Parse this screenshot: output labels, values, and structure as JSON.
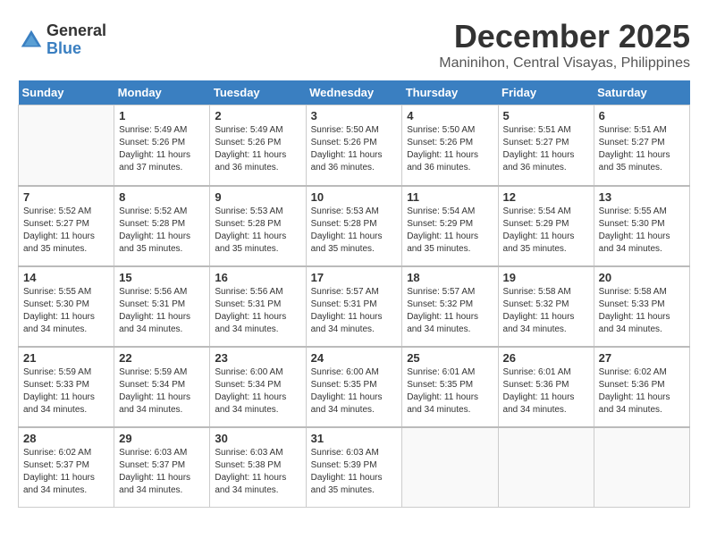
{
  "header": {
    "logo_general": "General",
    "logo_blue": "Blue",
    "month_year": "December 2025",
    "location": "Maninihon, Central Visayas, Philippines"
  },
  "calendar": {
    "days_of_week": [
      "Sunday",
      "Monday",
      "Tuesday",
      "Wednesday",
      "Thursday",
      "Friday",
      "Saturday"
    ],
    "weeks": [
      [
        {
          "day": "",
          "sunrise": "",
          "sunset": "",
          "daylight": ""
        },
        {
          "day": "1",
          "sunrise": "Sunrise: 5:49 AM",
          "sunset": "Sunset: 5:26 PM",
          "daylight": "Daylight: 11 hours and 37 minutes."
        },
        {
          "day": "2",
          "sunrise": "Sunrise: 5:49 AM",
          "sunset": "Sunset: 5:26 PM",
          "daylight": "Daylight: 11 hours and 36 minutes."
        },
        {
          "day": "3",
          "sunrise": "Sunrise: 5:50 AM",
          "sunset": "Sunset: 5:26 PM",
          "daylight": "Daylight: 11 hours and 36 minutes."
        },
        {
          "day": "4",
          "sunrise": "Sunrise: 5:50 AM",
          "sunset": "Sunset: 5:26 PM",
          "daylight": "Daylight: 11 hours and 36 minutes."
        },
        {
          "day": "5",
          "sunrise": "Sunrise: 5:51 AM",
          "sunset": "Sunset: 5:27 PM",
          "daylight": "Daylight: 11 hours and 36 minutes."
        },
        {
          "day": "6",
          "sunrise": "Sunrise: 5:51 AM",
          "sunset": "Sunset: 5:27 PM",
          "daylight": "Daylight: 11 hours and 35 minutes."
        }
      ],
      [
        {
          "day": "7",
          "sunrise": "Sunrise: 5:52 AM",
          "sunset": "Sunset: 5:27 PM",
          "daylight": "Daylight: 11 hours and 35 minutes."
        },
        {
          "day": "8",
          "sunrise": "Sunrise: 5:52 AM",
          "sunset": "Sunset: 5:28 PM",
          "daylight": "Daylight: 11 hours and 35 minutes."
        },
        {
          "day": "9",
          "sunrise": "Sunrise: 5:53 AM",
          "sunset": "Sunset: 5:28 PM",
          "daylight": "Daylight: 11 hours and 35 minutes."
        },
        {
          "day": "10",
          "sunrise": "Sunrise: 5:53 AM",
          "sunset": "Sunset: 5:28 PM",
          "daylight": "Daylight: 11 hours and 35 minutes."
        },
        {
          "day": "11",
          "sunrise": "Sunrise: 5:54 AM",
          "sunset": "Sunset: 5:29 PM",
          "daylight": "Daylight: 11 hours and 35 minutes."
        },
        {
          "day": "12",
          "sunrise": "Sunrise: 5:54 AM",
          "sunset": "Sunset: 5:29 PM",
          "daylight": "Daylight: 11 hours and 35 minutes."
        },
        {
          "day": "13",
          "sunrise": "Sunrise: 5:55 AM",
          "sunset": "Sunset: 5:30 PM",
          "daylight": "Daylight: 11 hours and 34 minutes."
        }
      ],
      [
        {
          "day": "14",
          "sunrise": "Sunrise: 5:55 AM",
          "sunset": "Sunset: 5:30 PM",
          "daylight": "Daylight: 11 hours and 34 minutes."
        },
        {
          "day": "15",
          "sunrise": "Sunrise: 5:56 AM",
          "sunset": "Sunset: 5:31 PM",
          "daylight": "Daylight: 11 hours and 34 minutes."
        },
        {
          "day": "16",
          "sunrise": "Sunrise: 5:56 AM",
          "sunset": "Sunset: 5:31 PM",
          "daylight": "Daylight: 11 hours and 34 minutes."
        },
        {
          "day": "17",
          "sunrise": "Sunrise: 5:57 AM",
          "sunset": "Sunset: 5:31 PM",
          "daylight": "Daylight: 11 hours and 34 minutes."
        },
        {
          "day": "18",
          "sunrise": "Sunrise: 5:57 AM",
          "sunset": "Sunset: 5:32 PM",
          "daylight": "Daylight: 11 hours and 34 minutes."
        },
        {
          "day": "19",
          "sunrise": "Sunrise: 5:58 AM",
          "sunset": "Sunset: 5:32 PM",
          "daylight": "Daylight: 11 hours and 34 minutes."
        },
        {
          "day": "20",
          "sunrise": "Sunrise: 5:58 AM",
          "sunset": "Sunset: 5:33 PM",
          "daylight": "Daylight: 11 hours and 34 minutes."
        }
      ],
      [
        {
          "day": "21",
          "sunrise": "Sunrise: 5:59 AM",
          "sunset": "Sunset: 5:33 PM",
          "daylight": "Daylight: 11 hours and 34 minutes."
        },
        {
          "day": "22",
          "sunrise": "Sunrise: 5:59 AM",
          "sunset": "Sunset: 5:34 PM",
          "daylight": "Daylight: 11 hours and 34 minutes."
        },
        {
          "day": "23",
          "sunrise": "Sunrise: 6:00 AM",
          "sunset": "Sunset: 5:34 PM",
          "daylight": "Daylight: 11 hours and 34 minutes."
        },
        {
          "day": "24",
          "sunrise": "Sunrise: 6:00 AM",
          "sunset": "Sunset: 5:35 PM",
          "daylight": "Daylight: 11 hours and 34 minutes."
        },
        {
          "day": "25",
          "sunrise": "Sunrise: 6:01 AM",
          "sunset": "Sunset: 5:35 PM",
          "daylight": "Daylight: 11 hours and 34 minutes."
        },
        {
          "day": "26",
          "sunrise": "Sunrise: 6:01 AM",
          "sunset": "Sunset: 5:36 PM",
          "daylight": "Daylight: 11 hours and 34 minutes."
        },
        {
          "day": "27",
          "sunrise": "Sunrise: 6:02 AM",
          "sunset": "Sunset: 5:36 PM",
          "daylight": "Daylight: 11 hours and 34 minutes."
        }
      ],
      [
        {
          "day": "28",
          "sunrise": "Sunrise: 6:02 AM",
          "sunset": "Sunset: 5:37 PM",
          "daylight": "Daylight: 11 hours and 34 minutes."
        },
        {
          "day": "29",
          "sunrise": "Sunrise: 6:03 AM",
          "sunset": "Sunset: 5:37 PM",
          "daylight": "Daylight: 11 hours and 34 minutes."
        },
        {
          "day": "30",
          "sunrise": "Sunrise: 6:03 AM",
          "sunset": "Sunset: 5:38 PM",
          "daylight": "Daylight: 11 hours and 34 minutes."
        },
        {
          "day": "31",
          "sunrise": "Sunrise: 6:03 AM",
          "sunset": "Sunset: 5:39 PM",
          "daylight": "Daylight: 11 hours and 35 minutes."
        },
        {
          "day": "",
          "sunrise": "",
          "sunset": "",
          "daylight": ""
        },
        {
          "day": "",
          "sunrise": "",
          "sunset": "",
          "daylight": ""
        },
        {
          "day": "",
          "sunrise": "",
          "sunset": "",
          "daylight": ""
        }
      ]
    ]
  }
}
